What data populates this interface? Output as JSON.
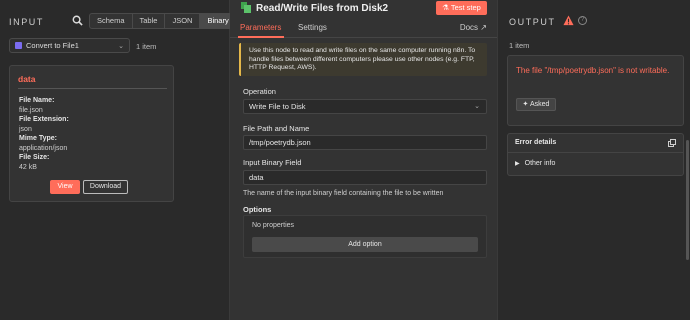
{
  "input_panel": {
    "title": "INPUT",
    "tabs": [
      {
        "label": "Schema",
        "active": false
      },
      {
        "label": "Table",
        "active": false
      },
      {
        "label": "JSON",
        "active": false
      },
      {
        "label": "Binary",
        "active": true
      }
    ],
    "node_select": {
      "value": "Convert to File1",
      "icon": "convert-to-file-node-icon"
    },
    "item_count": "1 item",
    "binary_card": {
      "title": "data",
      "fields": [
        {
          "key": "File Name:",
          "value": "file.json"
        },
        {
          "key": "File Extension:",
          "value": "json"
        },
        {
          "key": "Mime Type:",
          "value": "application/json"
        },
        {
          "key": "File Size:",
          "value": "42 kB"
        }
      ],
      "view_label": "View",
      "download_label": "Download"
    }
  },
  "node_panel": {
    "title": "Read/Write Files from Disk2",
    "test_step_label": "Test step",
    "tabs": [
      {
        "label": "Parameters",
        "active": true
      },
      {
        "label": "Settings",
        "active": false
      }
    ],
    "docs_label": "Docs",
    "notice": "Use this node to read and write files on the same computer running n8n. To handle files between different computers please use other nodes (e.g. FTP, HTTP Request, AWS).",
    "operation": {
      "label": "Operation",
      "value": "Write File to Disk"
    },
    "file_path": {
      "label": "File Path and Name",
      "value": "/tmp/poetrydb.json"
    },
    "binary_field": {
      "label": "Input Binary Field",
      "value": "data",
      "hint": "The name of the input binary field containing the file to be written"
    },
    "options": {
      "label": "Options",
      "empty_text": "No properties",
      "add_label": "Add option"
    }
  },
  "output_panel": {
    "title": "OUTPUT",
    "item_count": "1 item",
    "error_message": "The file \"/tmp/poetrydb.json\" is not writable.",
    "asked_label": "Asked",
    "error_details": {
      "title": "Error details",
      "row_label": "Other info"
    }
  },
  "colors": {
    "accent": "#ff6d5a",
    "warning_border": "#e5b84a",
    "node_icon": "#7b6cf0",
    "file_icon": "#3fa34d"
  }
}
